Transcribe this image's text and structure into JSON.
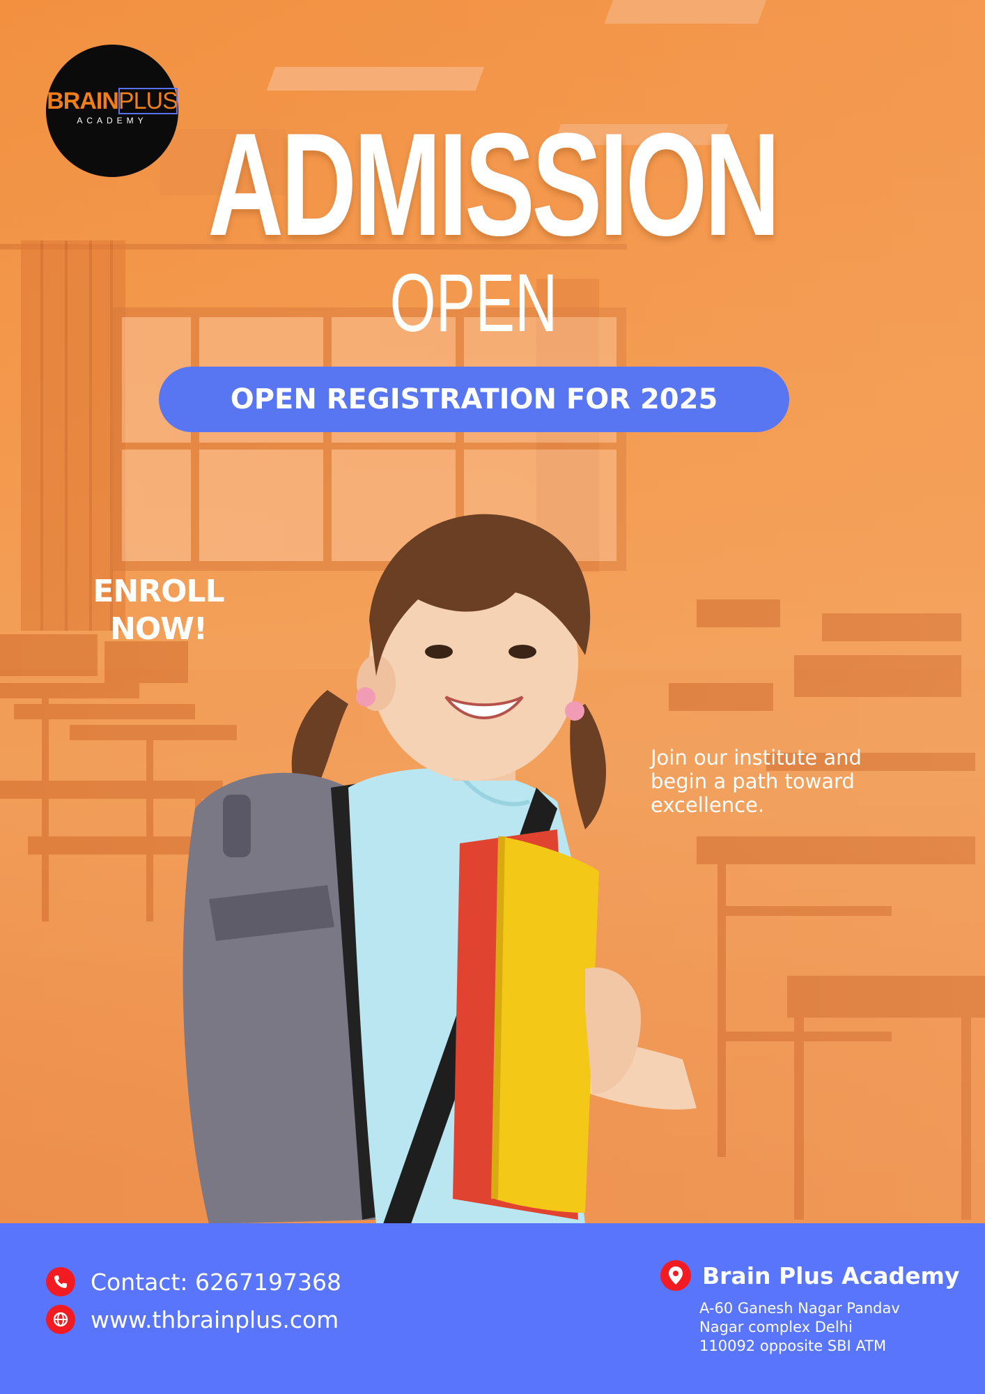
{
  "brand": {
    "logo_word_1": "BRAIN",
    "logo_word_2": "PLUS",
    "logo_sub": "ACADEMY"
  },
  "headline": "ADMISSION",
  "subheadline": "OPEN",
  "registration_banner": "OPEN REGISTRATION FOR 2025",
  "enroll_cta": {
    "line1": "ENROLL",
    "line2": "NOW!"
  },
  "tagline": "Join our institute and begin a path toward excellence.",
  "footer": {
    "contact": "Contact: 6267197368",
    "website": "www.thbrainplus.com",
    "address_title": "Brain Plus Academy",
    "address_line1": "A-60 Ganesh Nagar Pandav",
    "address_line2": "Nagar complex Delhi",
    "address_line3": "110092 opposite SBI ATM"
  },
  "colors": {
    "background_orange": "#f29040",
    "accent_blue": "#5875f2",
    "icon_red": "#f21b22",
    "logo_orange": "#f07f1a",
    "book_yellow": "#f3c816",
    "book_red": "#e0432f",
    "shirt_blue": "#b9e6f0",
    "backpack_gray": "#7b7886"
  },
  "icons": [
    "phone-icon",
    "globe-icon",
    "location-pin-icon"
  ]
}
